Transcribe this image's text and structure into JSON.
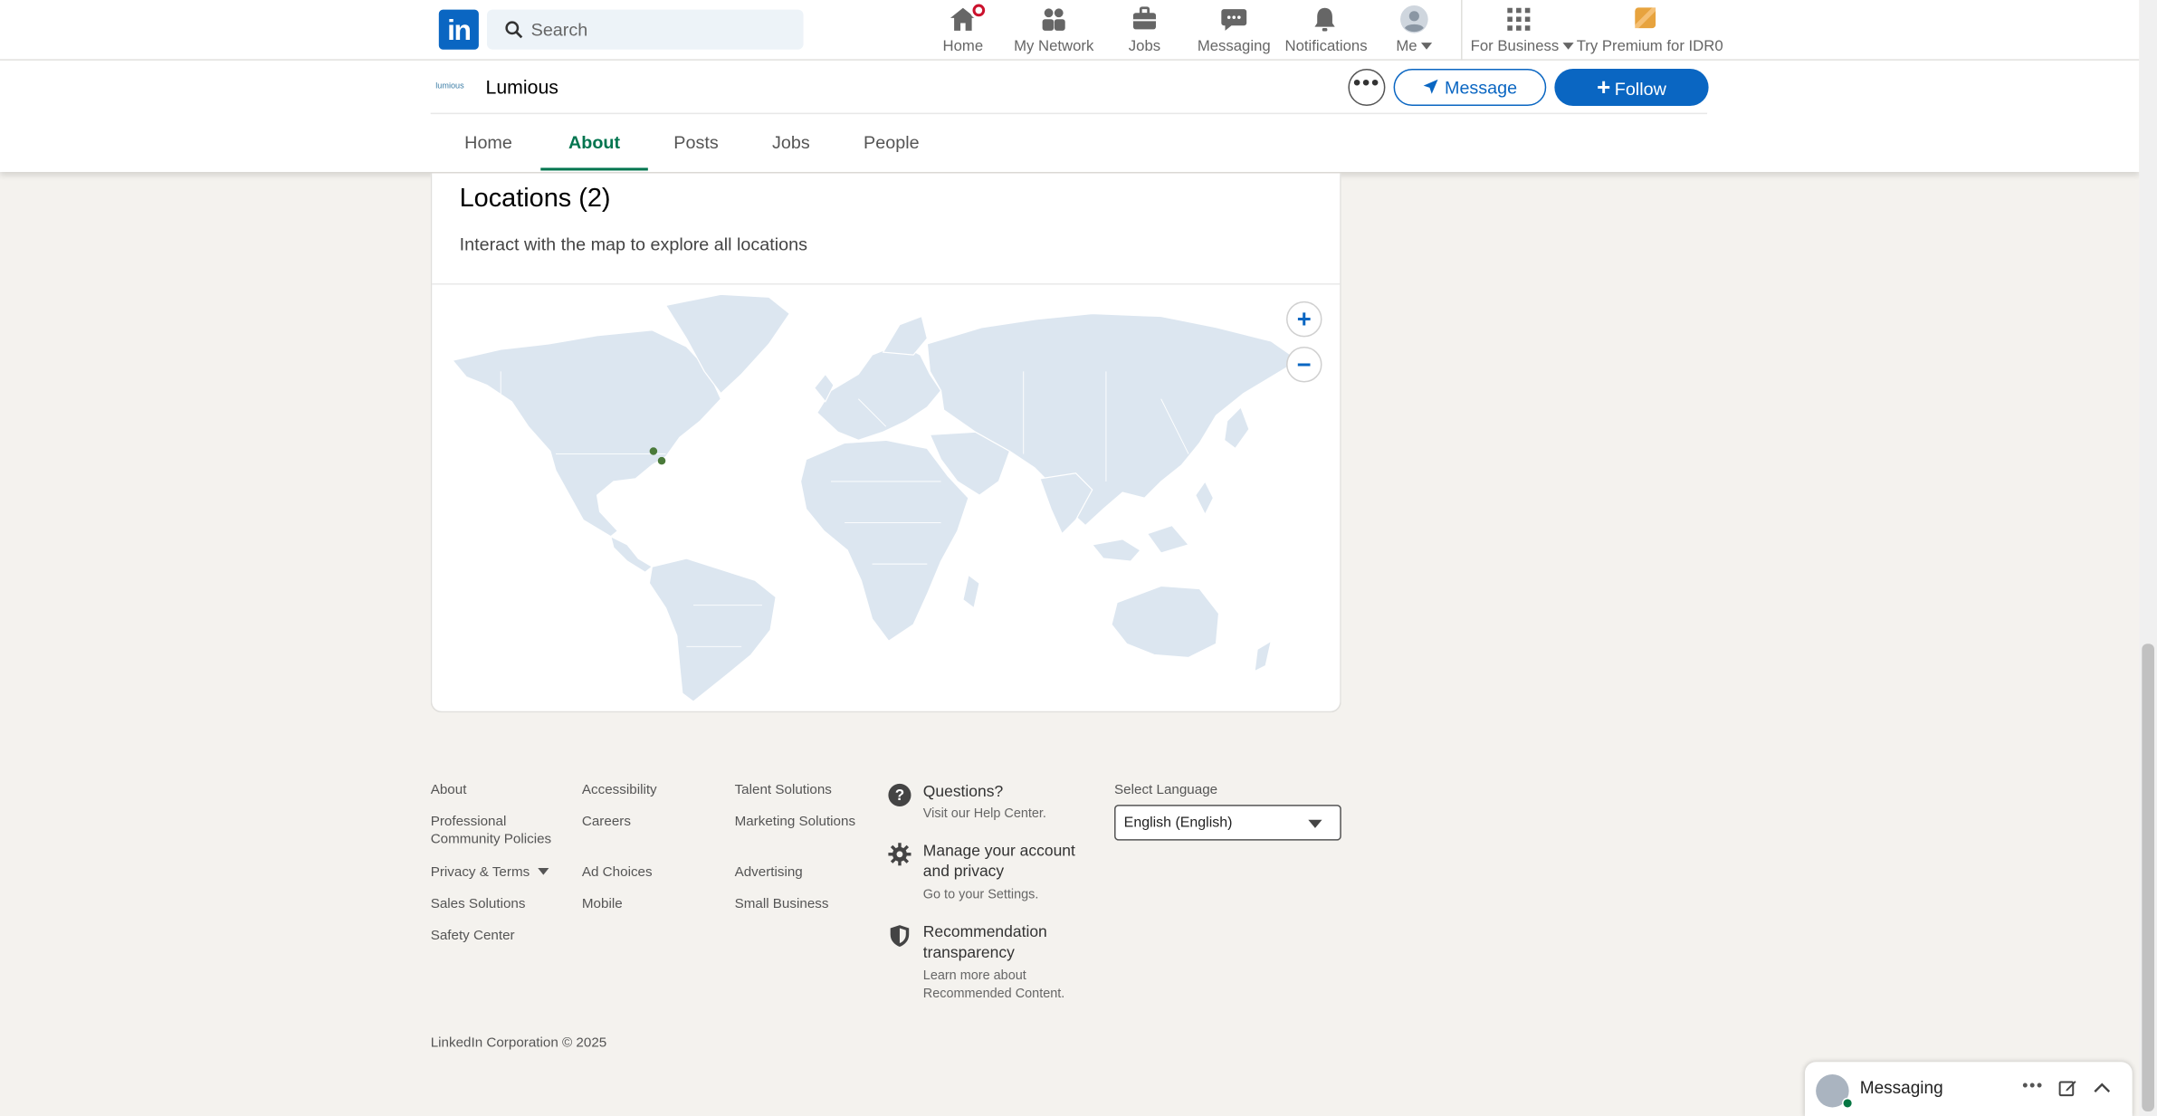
{
  "topnav": {
    "search_placeholder": "Search",
    "items": [
      {
        "label": "Home",
        "icon": "home-icon"
      },
      {
        "label": "My Network",
        "icon": "people-icon"
      },
      {
        "label": "Jobs",
        "icon": "briefcase-icon"
      },
      {
        "label": "Messaging",
        "icon": "chat-icon"
      },
      {
        "label": "Notifications",
        "icon": "bell-icon"
      },
      {
        "label": "Me",
        "icon": "avatar"
      },
      {
        "label": "For Business",
        "icon": "grid-icon"
      },
      {
        "label": "Try Premium for IDR0",
        "icon": "premium-icon"
      }
    ]
  },
  "company": {
    "logo_text": "lumious",
    "name": "Lumious",
    "message_label": "Message",
    "follow_label": "Follow",
    "tabs": [
      "Home",
      "About",
      "Posts",
      "Jobs",
      "People"
    ],
    "active_tab": "About"
  },
  "locations": {
    "title": "Locations (2)",
    "subtitle": "Interact with the map to explore all locations",
    "zoom_in": "+",
    "zoom_out": "−"
  },
  "footer": {
    "col1": [
      "About",
      "Professional Community Policies",
      "Privacy & Terms",
      "Sales Solutions",
      "Safety Center"
    ],
    "col2": [
      "Accessibility",
      "Careers",
      "Ad Choices",
      "Mobile"
    ],
    "col3": [
      "Talent Solutions",
      "Marketing Solutions",
      "Advertising",
      "Small Business"
    ],
    "help": [
      {
        "title": "Questions?",
        "desc": "Visit our Help Center."
      },
      {
        "title": "Manage your account and privacy",
        "desc": "Go to your Settings."
      },
      {
        "title": "Recommendation transparency",
        "desc": "Learn more about Recommended Content."
      }
    ],
    "language_label": "Select Language",
    "language_value": "English (English)",
    "copyright": "LinkedIn Corporation © 2025"
  },
  "messaging": {
    "title": "Messaging"
  },
  "colors": {
    "brand": "#0a66c2",
    "active_tab": "#01754f",
    "badge": "#cb112d",
    "map_land": "#dce6f0",
    "map_pin": "#4a7a3a"
  }
}
